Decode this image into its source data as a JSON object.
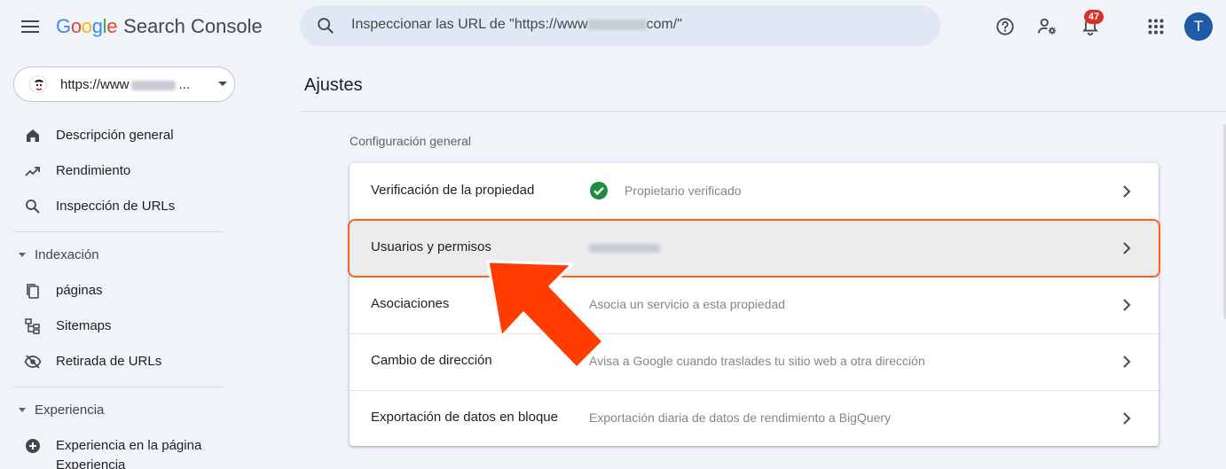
{
  "app": {
    "logo_google": "Google",
    "logo_product": "Search Console",
    "notifications_count": "47",
    "avatar_letter": "T"
  },
  "search": {
    "placeholder_prefix": "Inspeccionar las URL de \"https://www",
    "placeholder_suffix": "com/\""
  },
  "icons": {
    "menu": "menu-icon",
    "search": "search-icon",
    "help": "help-icon",
    "manage_users": "manage-accounts-icon",
    "notifications": "bell-icon",
    "apps": "apps-grid-icon"
  },
  "property": {
    "label": "https://www",
    "suffix": "..."
  },
  "sidebar": {
    "items": [
      {
        "label": "Descripción general",
        "icon": "home-icon"
      },
      {
        "label": "Rendimiento",
        "icon": "trending-up-icon"
      },
      {
        "label": "Inspección de URLs",
        "icon": "search-icon"
      }
    ],
    "indexing": {
      "title": "Indexación",
      "items": [
        {
          "label": "páginas",
          "icon": "pages-icon"
        },
        {
          "label": "Sitemaps",
          "icon": "sitemap-icon"
        },
        {
          "label": "Retirada de URLs",
          "icon": "visibility-off-icon"
        }
      ]
    },
    "experience": {
      "title": "Experiencia",
      "items": [
        {
          "label": "Experiencia en la página",
          "icon": "add-circle-icon"
        },
        {
          "label": "Experiencia",
          "icon": "partial-item"
        }
      ]
    }
  },
  "main": {
    "title": "Ajustes",
    "section_title": "Configuración general",
    "rows": [
      {
        "label": "Verificación de la propiedad",
        "description": "Propietario verificado"
      },
      {
        "label": "Usuarios y permisos",
        "description": ""
      },
      {
        "label": "Asociaciones",
        "description": "Asocia un servicio a esta propiedad"
      },
      {
        "label": "Cambio de dirección",
        "description": "Avisa a Google cuando traslades tu sitio web a otra dirección"
      },
      {
        "label": "Exportación de datos en bloque",
        "description": "Exportación diaria de datos de rendimiento a BigQuery"
      }
    ]
  },
  "colors": {
    "background": "#f0f4f9",
    "search_bg": "#e1e8f5",
    "highlight_border": "#f26522",
    "arrow": "#ff3d00",
    "verified_green": "#1e8e3e",
    "badge_red": "#d93025",
    "avatar_blue": "#1f5aa6"
  }
}
